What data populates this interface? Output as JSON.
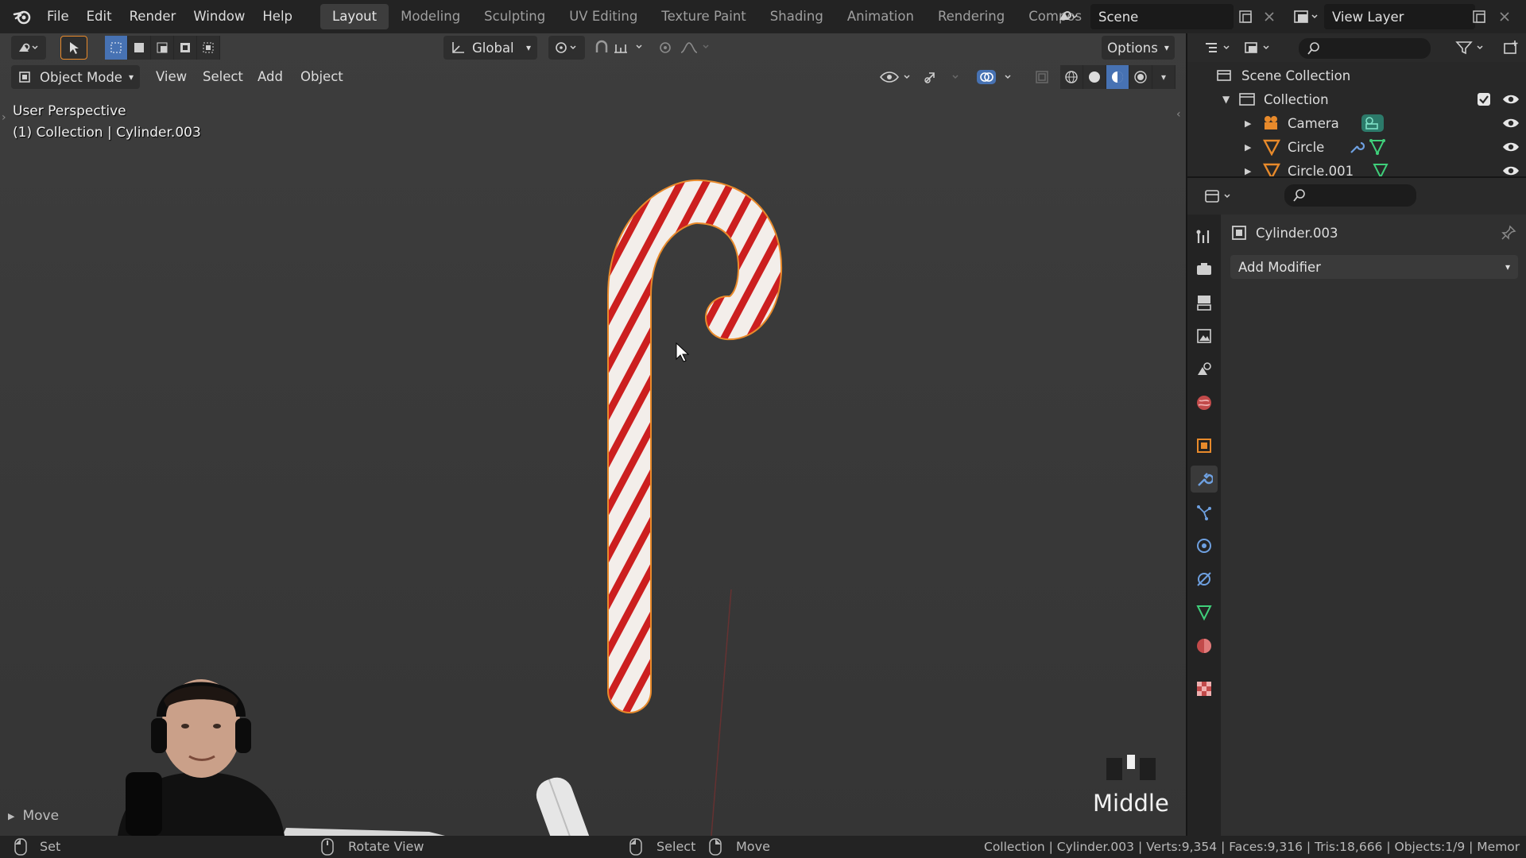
{
  "topbar": {
    "menu": [
      "File",
      "Edit",
      "Render",
      "Window",
      "Help"
    ],
    "workspaces": [
      "Layout",
      "Modeling",
      "Sculpting",
      "UV Editing",
      "Texture Paint",
      "Shading",
      "Animation",
      "Rendering",
      "Compos"
    ],
    "active_workspace": "Layout",
    "scene": "Scene",
    "view_layer": "View Layer"
  },
  "viewport": {
    "orientation": "Global",
    "options_label": "Options",
    "mode": "Object Mode",
    "header_menu": [
      "View",
      "Select",
      "Add",
      "Object"
    ],
    "overlay_line1": "User Perspective",
    "overlay_line2": "(1) Collection | Cylinder.003",
    "last_op": "Move",
    "mouse_hint": "Middle"
  },
  "outliner": {
    "root": "Scene Collection",
    "collection": "Collection",
    "items": [
      "Camera",
      "Circle",
      "Circle.001"
    ]
  },
  "properties": {
    "object_name": "Cylinder.003",
    "add_modifier": "Add Modifier"
  },
  "statusbar": {
    "left_hint": "Set",
    "rotate": "Rotate View",
    "select": "Select",
    "move": "Move",
    "stats": "Collection | Cylinder.003 | Verts:9,354 | Faces:9,316 | Tris:18,666 | Objects:1/9 | Memor"
  },
  "colors": {
    "accent": "#4772b3",
    "active_orange": "#e88a2b",
    "stripe_red": "#cc1f1f",
    "stripe_white": "#f2f2f2"
  }
}
